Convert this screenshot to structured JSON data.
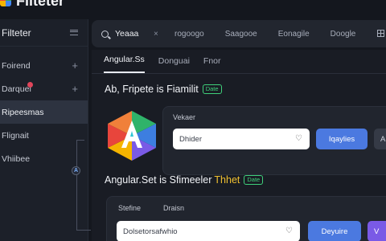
{
  "app": {
    "title": "Filteter",
    "logo_colors": [
      "#e8453c",
      "#3aa757",
      "#f5b400",
      "#4285f4"
    ]
  },
  "sidebar": {
    "title": "Filteter",
    "items": [
      {
        "label": "Foirend",
        "has_plus": true
      },
      {
        "label": "Darquel",
        "has_plus": true,
        "has_badge": true
      },
      {
        "label": "Ripeesmas",
        "active": true
      },
      {
        "label": "Flignait"
      },
      {
        "label": "Vhiibee"
      }
    ],
    "tree_node_letter": "A"
  },
  "topbar": {
    "search_value": "Yeaaa",
    "clear_symbol": "×",
    "links": [
      "rogoogo",
      "Saagooe",
      "Eonagile",
      "Doogle"
    ],
    "icon": "grid-icon"
  },
  "tabs": [
    {
      "label": "Angular.Ss",
      "active": true
    },
    {
      "label": "Donguai"
    },
    {
      "label": "Fnor"
    }
  ],
  "section1": {
    "heading": "Ab, Fripete is Fiamilit",
    "badge": "Date",
    "card_label": "Vekaer",
    "input_value": "Dhider",
    "primary_button": "Iqaylies",
    "secondary_button": "A"
  },
  "section2": {
    "heading_main": "Angular.Set is Sfimeeler",
    "heading_accent": "Thhet",
    "badge": "Date",
    "labels": [
      "Stefine",
      "Draisn"
    ],
    "input_value": "Dolsetorsafwhio",
    "primary_button": "Deyuire",
    "secondary_button": "V"
  },
  "logo": {
    "letter": "A",
    "colors": {
      "red": "#e8453c",
      "green": "#2fb36a",
      "yellow": "#f5b400",
      "blue": "#3d7ee0",
      "cyan": "#2ec7d6",
      "purple": "#7a5ae6"
    }
  },
  "colors": {
    "accent_blue": "#4b79e0",
    "accent_purple": "#7a5ae6",
    "badge_green": "#3fd07a",
    "highlight_yellow": "#f0c030"
  }
}
